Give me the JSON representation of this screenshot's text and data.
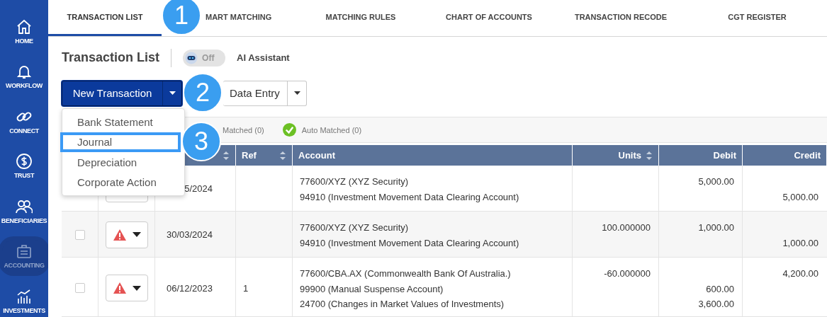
{
  "sidebar": {
    "items": [
      {
        "label": "HOME",
        "selected": false
      },
      {
        "label": "WORKFLOW",
        "selected": false
      },
      {
        "label": "CONNECT",
        "selected": false
      },
      {
        "label": "TRUST",
        "selected": false
      },
      {
        "label": "BENEFICIARIES",
        "selected": false
      },
      {
        "label": "ACCOUNTING",
        "selected": true
      },
      {
        "label": "INVESTMENTS",
        "selected": false
      }
    ]
  },
  "tabs": [
    {
      "label": "TRANSACTION LIST",
      "selected": true
    },
    {
      "label": "MART MATCHING",
      "selected": false
    },
    {
      "label": "MATCHING RULES",
      "selected": false
    },
    {
      "label": "CHART OF ACCOUNTS",
      "selected": false
    },
    {
      "label": "TRANSACTION RECODE",
      "selected": false
    },
    {
      "label": "CGT REGISTER",
      "selected": false
    }
  ],
  "page": {
    "title": "Transaction List",
    "ai_toggle": {
      "on": false,
      "label": "Off"
    },
    "ai_label": "AI Assistant"
  },
  "buttons": {
    "new_transaction": "New Transaction",
    "data_entry": "Data Entry"
  },
  "menu": {
    "items": [
      {
        "label": "Bank Statement",
        "selected": false
      },
      {
        "label": "Journal",
        "selected": true
      },
      {
        "label": "Depreciation",
        "selected": false
      },
      {
        "label": "Corporate Action",
        "selected": false
      }
    ]
  },
  "callouts": [
    "1",
    "2",
    "3"
  ],
  "filters": [
    {
      "label": "Matched (0)",
      "kind": "plain"
    },
    {
      "label": "Auto Matched (0)",
      "kind": "check"
    }
  ],
  "table": {
    "columns": [
      {
        "sortable": true
      },
      {
        "label": "Ref",
        "sortable": true
      },
      {
        "label": "Account",
        "sortable": false
      },
      {
        "label": "Units",
        "sortable": true
      },
      {
        "label": "Debit",
        "sortable": false
      },
      {
        "label": "Credit",
        "sortable": false
      }
    ],
    "rows": [
      {
        "kind": "covered",
        "date": "5/2024",
        "lines": [
          {
            "account": "77600/XYZ (XYZ Security)",
            "debit": "5,000.00"
          },
          {
            "account": "94910 (Investment Movement Data Clearing Account)",
            "credit": "5,000.00"
          }
        ]
      },
      {
        "kind": "warning",
        "checked": false,
        "date": "30/03/2024",
        "lines": [
          {
            "account": "77600/XYZ (XYZ Security)",
            "units": "100.000000",
            "debit": "1,000.00"
          },
          {
            "account": "94910 (Investment Movement Data Clearing Account)",
            "credit": "1,000.00"
          }
        ]
      },
      {
        "kind": "warning",
        "checked": false,
        "date": "06/12/2023",
        "ref": "1",
        "lines": [
          {
            "account": "77600/CBA.AX (Commonwealth Bank Of Australia.)",
            "units": "-60.000000",
            "credit": "4,200.00"
          },
          {
            "account": "99900 (Manual Suspense Account)",
            "debit": "600.00"
          },
          {
            "account": "24700 (Changes in Market Values of Investments)",
            "debit": "3,600.00"
          }
        ]
      }
    ]
  }
}
